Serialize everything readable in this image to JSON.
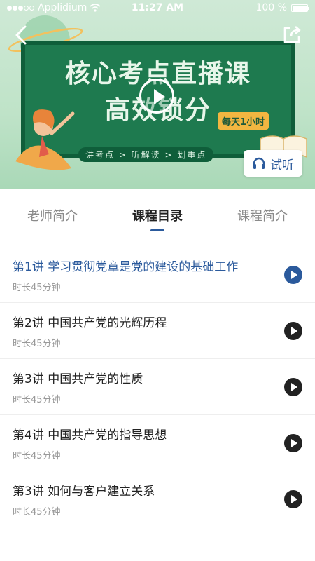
{
  "status_bar": {
    "carrier": "Applidium",
    "time": "11:27 AM",
    "battery": "100 %"
  },
  "banner": {
    "title_line1": "核心考点直播课",
    "title_line2": "高效锁分",
    "daily_badge": "每天1小时",
    "subtitle": "讲考点 > 听解读 > 划重点",
    "trial_label": "试听",
    "icons": [
      "back-arrow-icon",
      "share-icon",
      "play-icon",
      "headphones-icon"
    ]
  },
  "tabs": [
    {
      "label": "老师简介",
      "active": false
    },
    {
      "label": "课程目录",
      "active": true
    },
    {
      "label": "课程简介",
      "active": false
    }
  ],
  "lessons": [
    {
      "title": "第1讲  学习贯彻党章是党的建设的基础工作",
      "duration": "时长45分钟",
      "active": true
    },
    {
      "title": "第2讲  中国共产党的光辉历程",
      "duration": "时长45分钟",
      "active": false
    },
    {
      "title": "第3讲  中国共产党的性质",
      "duration": "时长45分钟",
      "active": false
    },
    {
      "title": "第4讲  中国共产党的指导思想",
      "duration": "时长45分钟",
      "active": false
    },
    {
      "title": "第3讲  如何与客户建立关系",
      "duration": "时长45分钟",
      "active": false
    }
  ],
  "colors": {
    "accent": "#2b5a9c",
    "board": "#1e7a4f",
    "badge": "#f2b641"
  }
}
